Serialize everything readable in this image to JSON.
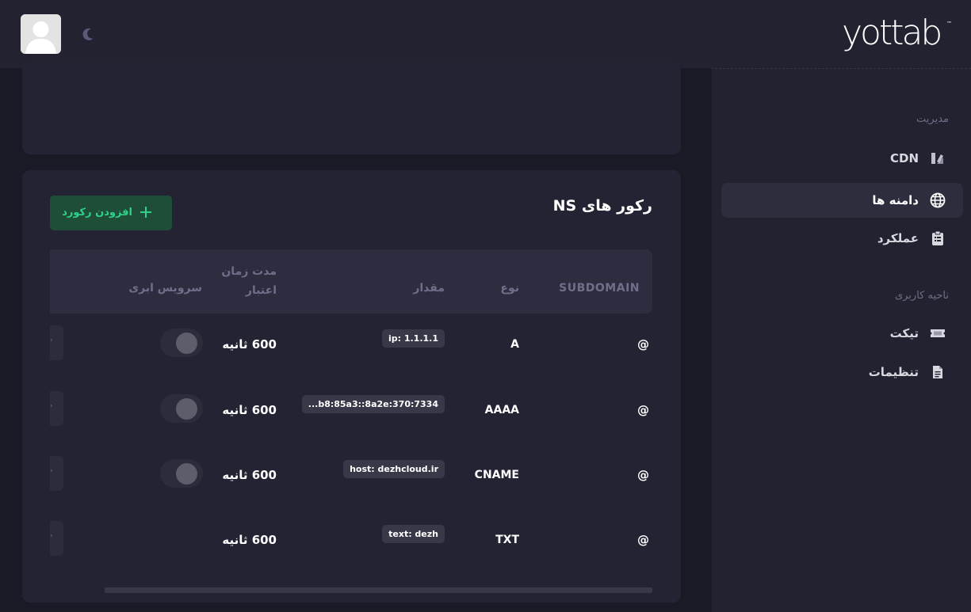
{
  "brand": {
    "logo": "yottab",
    "trademark": "™"
  },
  "header": {
    "avatar_icon": "user-avatar-icon",
    "theme_icon": "moon-icon"
  },
  "sidebar": {
    "section_admin": "مدیریت",
    "section_user": "ناحیه کاربری",
    "items": [
      {
        "label": "CDN",
        "icon": "cdn-icon",
        "active": false
      },
      {
        "label": "دامنه ها",
        "icon": "globe-icon",
        "active": true
      },
      {
        "label": "عملکرد",
        "icon": "clipboard-icon",
        "active": false
      },
      {
        "label": "تیکت",
        "icon": "ticket-icon",
        "active": false
      },
      {
        "label": "تنظیمات",
        "icon": "document-icon",
        "active": false
      }
    ]
  },
  "records": {
    "title": "رکور های NS",
    "add_button": "افزودن رکورد",
    "columns": {
      "subdomain": "SUBDOMAIN",
      "type": "نوع",
      "value": "مقدار",
      "ttl_line1": "مدت زمان",
      "ttl_line2": "اعتبار",
      "cloud": "سرویس ابری"
    },
    "rows": [
      {
        "subdomain": "@",
        "type": "A",
        "value": "ip: 1.1.1.1",
        "ttl": "600 ثانیه",
        "cloud": true
      },
      {
        "subdomain": "@",
        "type": "AAAA",
        "value": "...b8:85a3::8a2e:370:7334",
        "ttl": "600 ثانیه",
        "cloud": true
      },
      {
        "subdomain": "@",
        "type": "CNAME",
        "value": "host: dezhcloud.ir",
        "ttl": "600 ثانیه",
        "cloud": true
      },
      {
        "subdomain": "@",
        "type": "TXT",
        "value": "text: dezh",
        "ttl": "600 ثانیه",
        "cloud": false
      }
    ]
  },
  "colors": {
    "accent_green": "#2fd18a",
    "panel": "#232333",
    "background": "#1a1a26"
  }
}
